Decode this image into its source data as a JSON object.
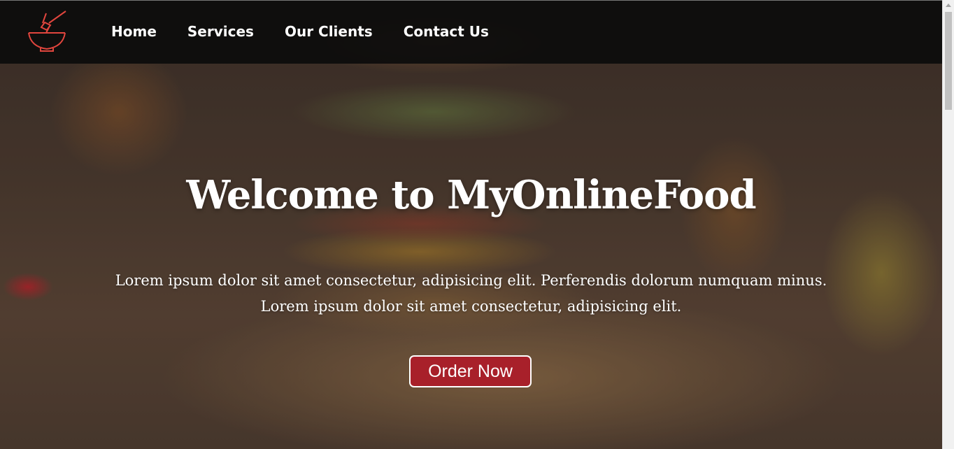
{
  "nav": {
    "logo": {
      "icon": "food-bowl-icon",
      "color": "#e2463e"
    },
    "links": [
      {
        "label": "Home"
      },
      {
        "label": "Services"
      },
      {
        "label": "Our Clients"
      },
      {
        "label": "Contact Us"
      }
    ]
  },
  "hero": {
    "title": "Welcome to MyOnlineFood",
    "text_line1": "Lorem ipsum dolor sit amet consectetur, adipisicing elit. Perferendis dolorum numquam minus.",
    "text_line2": "Lorem ipsum dolor sit amet consectetur, adipisicing elit.",
    "button_label": "Order Now",
    "button_color": "#a8202a"
  }
}
